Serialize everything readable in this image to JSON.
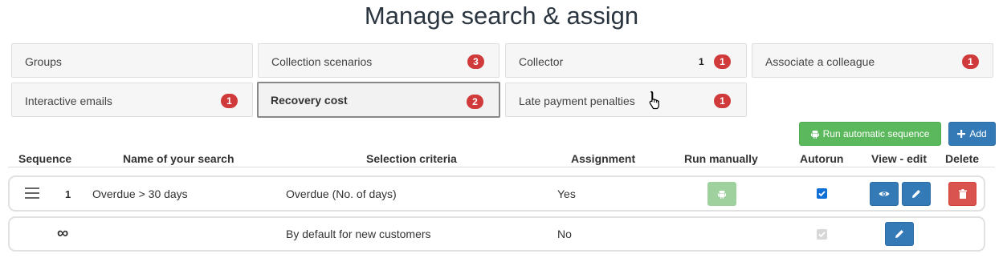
{
  "page": {
    "title": "Manage search & assign"
  },
  "tiles": [
    {
      "label": "Groups"
    },
    {
      "label": "Collection scenarios",
      "badge": "3"
    },
    {
      "label": "Collector",
      "count": "1",
      "badge": "1"
    },
    {
      "label": "Associate a colleague",
      "badge": "1"
    },
    {
      "label": "Interactive emails",
      "badge": "1"
    },
    {
      "label": "Recovery cost",
      "badge": "2",
      "active": true
    },
    {
      "label": "Late payment penalties",
      "badge": "1"
    }
  ],
  "toolbar": {
    "run_sequence_label": "Run automatic sequence",
    "add_label": "Add"
  },
  "table": {
    "headers": {
      "sequence": "Sequence",
      "name": "Name of your search",
      "criteria": "Selection criteria",
      "assignment": "Assignment",
      "run_manually": "Run manually",
      "autorun": "Autorun",
      "view_edit": "View - edit",
      "delete": "Delete"
    },
    "rows": [
      {
        "sequence": "1",
        "name": "Overdue > 30 days",
        "criteria": "Overdue (No. of days)",
        "assignment": "Yes",
        "autorun": true
      },
      {
        "sequence": "∞",
        "name": "",
        "criteria": "By default for new customers",
        "assignment": "No",
        "autorun": true
      }
    ]
  },
  "colors": {
    "badge": "#d13a3a",
    "primary": "#337ab7",
    "success": "#5cb85c",
    "danger": "#d9534f"
  },
  "icons": {
    "drag": "drag-handle-icon",
    "robot": "android-robot-icon",
    "eye": "eye-icon",
    "pencil": "pencil-icon",
    "trash": "trash-icon",
    "plus": "plus-icon",
    "check": "check-icon"
  }
}
